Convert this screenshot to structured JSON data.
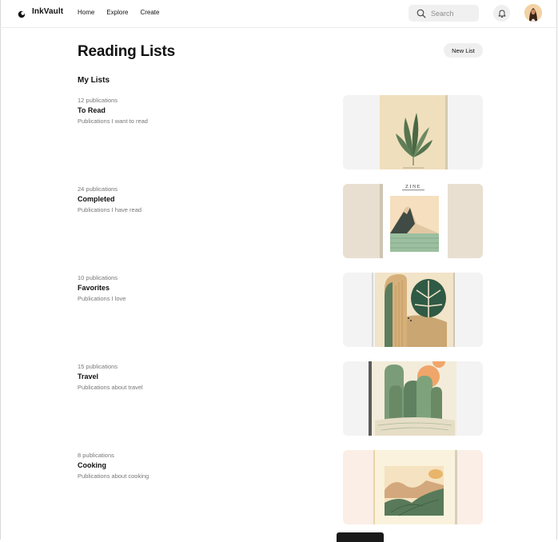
{
  "app": {
    "name": "InkVault"
  },
  "nav": {
    "items": [
      "Home",
      "Explore",
      "Create"
    ]
  },
  "search": {
    "placeholder": "Search"
  },
  "page": {
    "title": "Reading Lists",
    "new_list_label": "New List",
    "section_title": "My Lists"
  },
  "lists": [
    {
      "count": "12 publications",
      "name": "To Read",
      "description": "Publications I want to read",
      "cover": "leaf-plant"
    },
    {
      "count": "24 publications",
      "name": "Completed",
      "description": "Publications I have read",
      "cover": "zine-mountain",
      "cover_text": "ZINE"
    },
    {
      "count": "10 publications",
      "name": "Favorites",
      "description": "Publications I love",
      "cover": "monstera-arch"
    },
    {
      "count": "15 publications",
      "name": "Travel",
      "description": "Publications about travel",
      "cover": "cactus-sun"
    },
    {
      "count": "8 publications",
      "name": "Cooking",
      "description": "Publications about cooking",
      "cover": "abstract-landscape"
    }
  ],
  "colors": {
    "accent_green": "#5c7a5a",
    "paper": "#f3e3c4",
    "text": "#111111",
    "muted": "#777777"
  }
}
